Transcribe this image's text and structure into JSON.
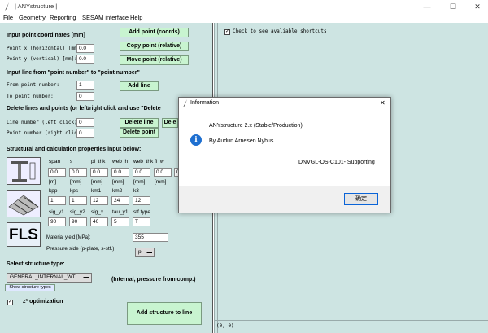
{
  "window": {
    "title": "| ANYstructure |",
    "minimize": "—",
    "maximize": "☐",
    "close": "✕"
  },
  "menu": [
    "File",
    "Geometry",
    "Reporting",
    "SESAM interface",
    "Help"
  ],
  "point_section": {
    "heading": "Input point coordinates [mm]",
    "x_label": "Point x (horizontal) [mm]:",
    "y_label": "Point y (vertical)   [mm]:",
    "x_value": "0.0",
    "y_value": "0.0",
    "add_point": "Add point (coords)",
    "copy_point": "Copy point (relative)",
    "move_point": "Move point (relative)"
  },
  "line_section": {
    "heading": "Input line from \"point number\" to \"point number\"",
    "from_label": "From point number:",
    "to_label": "To point number:",
    "from_value": "1",
    "to_value": "0",
    "add_line": "Add line"
  },
  "delete_section": {
    "heading": "Delete lines and points (or left/right click and use \"Delete",
    "line_label": "Line number (left click):",
    "point_label": "Point number (right click):",
    "line_value": "0",
    "point_value": "0",
    "delete_line": "Delete line",
    "delete_line_2": "Dele",
    "delete_point": "Delete point"
  },
  "structure_section": {
    "heading": "Structural and calculation properties input below:",
    "row1_headers": [
      "span",
      "s",
      "pl_thk",
      "web_h",
      "web_thk",
      "fl_w"
    ],
    "row1_values": [
      "0.0",
      "0.0",
      "0.0",
      "0.0",
      "0.0",
      "0.0"
    ],
    "row1_units": [
      "[m]",
      "[mm]",
      "[mm]",
      "[mm]",
      "[mm]",
      "[mm]"
    ],
    "row1_extra_value": "0.0",
    "row2_headers": [
      "kpp",
      "kps",
      "km1",
      "km2",
      "k3"
    ],
    "row2_values": [
      "1",
      "1",
      "12",
      "24",
      "12"
    ],
    "row3_headers": [
      "sig_y1",
      "sig_y2",
      "sig_x",
      "tau_y1",
      "stf type"
    ],
    "row3_values": [
      "90",
      "90",
      "40",
      "5",
      "T"
    ],
    "fls_label": "FLS",
    "yield_label": "Material yield [MPa]:",
    "yield_value": "355",
    "pressure_label": "Pressure side (p-plate, s-stf.):",
    "pressure_value": "p"
  },
  "select_section": {
    "heading": "Select structure type:",
    "selected": "GENERAL_INTERNAL_WT",
    "note": "(Internal, pressure from comp.)",
    "show_types": "Show structure types",
    "z_opt_label": "z* optimization",
    "z_opt_checked": "✓",
    "add_structure": "Add structure to line"
  },
  "canvas": {
    "shortcut_label": "Check to see avaliable shortcuts",
    "shortcut_checked": "✓",
    "coords": "(0, 0)"
  },
  "dialog": {
    "title": "Information",
    "close": "✕",
    "icon": "i",
    "line1": "ANYstructure 2.x (Stable/Production)",
    "line2": "By Audun Arnesen Nyhus",
    "line3": "DNVGL-OS-C101- Supporting",
    "ok": "确定"
  },
  "colors": {
    "panel_bg": "#cde4e2",
    "button_bg": "#c8f4d0",
    "dialog_accent": "#1e6fd0"
  }
}
